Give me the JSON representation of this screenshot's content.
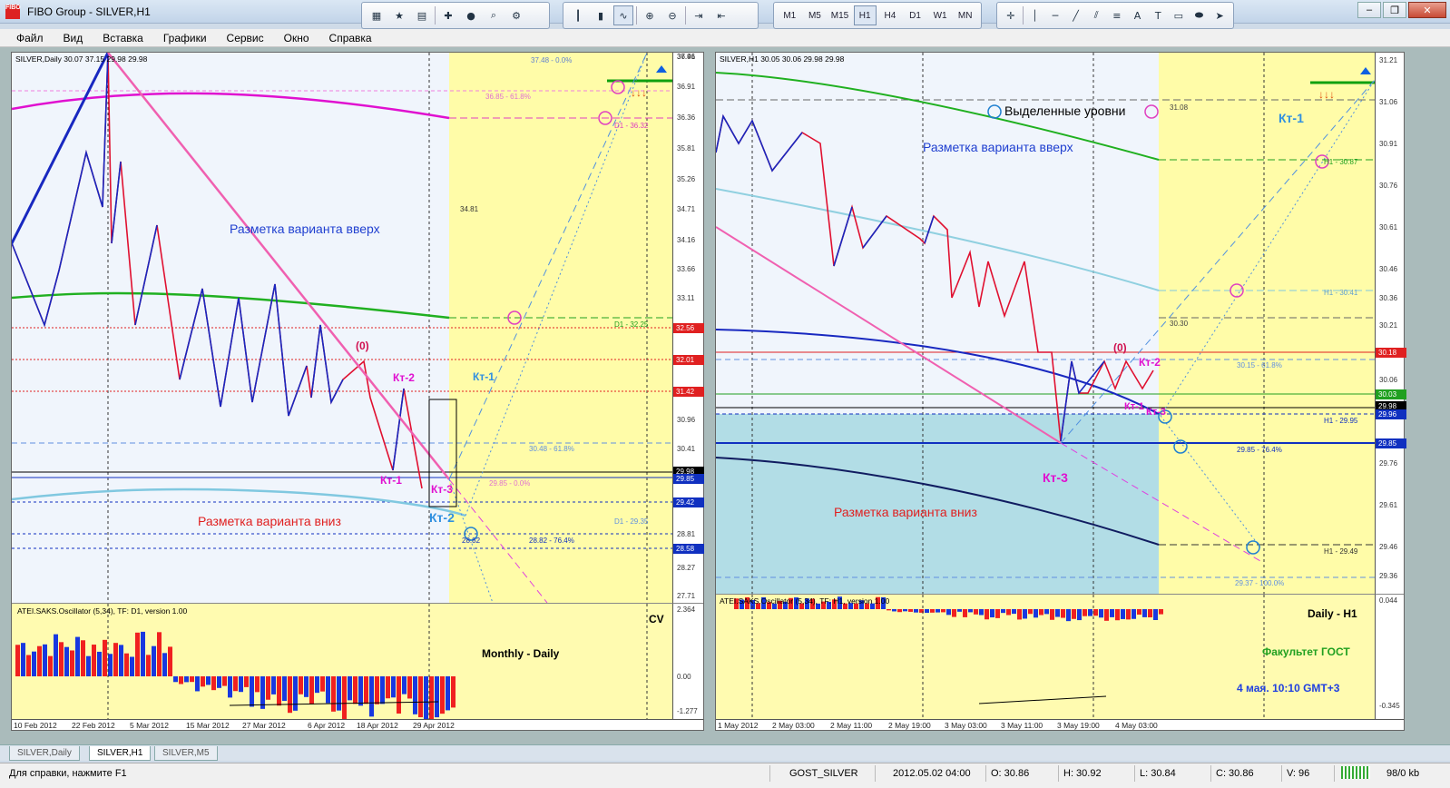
{
  "window": {
    "title": "FIBO Group - SILVER,H1",
    "min": "–",
    "max": "❐",
    "close": "✕",
    "logo": "FIBO"
  },
  "menu": [
    "Файл",
    "Вид",
    "Вставка",
    "Графики",
    "Сервис",
    "Окно",
    "Справка"
  ],
  "timeframes": [
    "M1",
    "M5",
    "M15",
    "H1",
    "H4",
    "D1",
    "W1",
    "MN"
  ],
  "toolbar_tools": {
    "text": "A",
    "label_tool": "T"
  },
  "tabs": [
    "SILVER,Daily",
    "SILVER,H1",
    "SILVER,M5"
  ],
  "status": {
    "help": "Для справки, нажмите F1",
    "profile": "GOST_SILVER",
    "datetime": "2012.05.02 04:00",
    "open": "O: 30.86",
    "high": "H: 30.92",
    "low": "L: 30.84",
    "close": "C: 30.86",
    "volume": "V: 96",
    "traffic": "98/0 kb"
  },
  "left": {
    "header": "SILVER,Daily  30.07 37.15 29.98 29.98",
    "axis_ticks": [
      "37.46",
      "36.91",
      "36.36",
      "35.81",
      "35.26",
      "34.71",
      "34.16",
      "33.66",
      "33.11",
      "32.56",
      "32.01",
      "31.42",
      "30.96",
      "30.41",
      "29.85",
      "29.42",
      "28.81",
      "28.58",
      "28.27",
      "27.71"
    ],
    "price_tags": [
      {
        "v": "32.56",
        "c": "#e02020"
      },
      {
        "v": "32.01",
        "c": "#e02020"
      },
      {
        "v": "31.42",
        "c": "#e02020"
      },
      {
        "v": "29.98",
        "c": "#000000"
      },
      {
        "v": "29.85",
        "c": "#1030c0"
      },
      {
        "v": "29.42",
        "c": "#1030c0"
      },
      {
        "v": "28.58",
        "c": "#1030c0"
      }
    ],
    "levels": {
      "l1": "37.48 - 0.0%",
      "l2": "36.85 - 61.8%",
      "l3": "D1 - 36.32",
      "l4": "34.81",
      "l5": "D1 - 32.25",
      "l6": "30.48 - 61.8%",
      "l7": "29.85 - 0.0%",
      "l8": "D1 - 29.35",
      "l9": "28.82 - 76.4%",
      "l10": "28.82"
    },
    "labels": {
      "up": "Разметка варианта вверх",
      "down": "Разметка варианта вниз",
      "zero": "(0)",
      "kt1": "Кт-1",
      "kt2": "Кт-2",
      "kt3": "Кт-3",
      "kt1b": "Кт-1",
      "kt2b": "Кт-2"
    },
    "osc": {
      "header": "ATEI.SAKS.Oscillator (5,34), TF: D1, version 1.00",
      "title": "Monthly - Daily",
      "cv": "CV",
      "top": "2.364",
      "zero": "0.00",
      "bottom": "-1.277"
    },
    "time_labels": [
      "10 Feb 2012",
      "22 Feb 2012",
      "5 Mar 2012",
      "15 Mar 2012",
      "27 Mar 2012",
      "6 Apr 2012",
      "18 Apr 2012",
      "29 Apr 2012"
    ]
  },
  "right": {
    "header": "SILVER,H1  30.05 30.06 29.98 29.98",
    "axis_ticks": [
      "31.21",
      "31.06",
      "30.91",
      "30.76",
      "30.61",
      "30.46",
      "30.36",
      "30.21",
      "30.06",
      "29.91",
      "29.76",
      "29.61",
      "29.46",
      "29.36",
      "0.044"
    ],
    "price_tags": [
      {
        "v": "30.18",
        "c": "#e02020"
      },
      {
        "v": "30.03",
        "c": "#20a020"
      },
      {
        "v": "29.98",
        "c": "#000000"
      },
      {
        "v": "29.96",
        "c": "#1030c0"
      },
      {
        "v": "29.85",
        "c": "#1030c0"
      }
    ],
    "levels": {
      "l1": "31.08",
      "l2": "H1 - 30.87",
      "l3": "H1 - 30.41",
      "l4": "30.30",
      "l5": "30.15 - 61.8%",
      "l6": "H1 - 29.95",
      "l7": "29.85 - 76.4%",
      "l8": "H1 - 29.49",
      "l9": "29.37 - 100.0%"
    },
    "labels": {
      "sel": "Выделенные уровни",
      "up": "Разметка варианта вверх",
      "down": "Разметка варианта вниз",
      "zero": "(0)",
      "kt1": "Кт-1",
      "kt2": "Кт-2",
      "kt3": "Кт-3",
      "kt1b": "Кт-1",
      "kt3b": "Кт-3"
    },
    "osc": {
      "header": "ATEI.SAKS.Oscillator (5,34), TF: H1, version 1.00",
      "title": "Daily - H1",
      "faculty": "Факультет ГОСТ",
      "time": "4 мая. 10:10 GMT+3",
      "bottom": "-0.345"
    },
    "time_labels": [
      "1 May 2012",
      "2 May 03:00",
      "2 May 11:00",
      "2 May 19:00",
      "3 May 03:00",
      "3 May 11:00",
      "3 May 19:00",
      "4 May 03:00"
    ]
  }
}
